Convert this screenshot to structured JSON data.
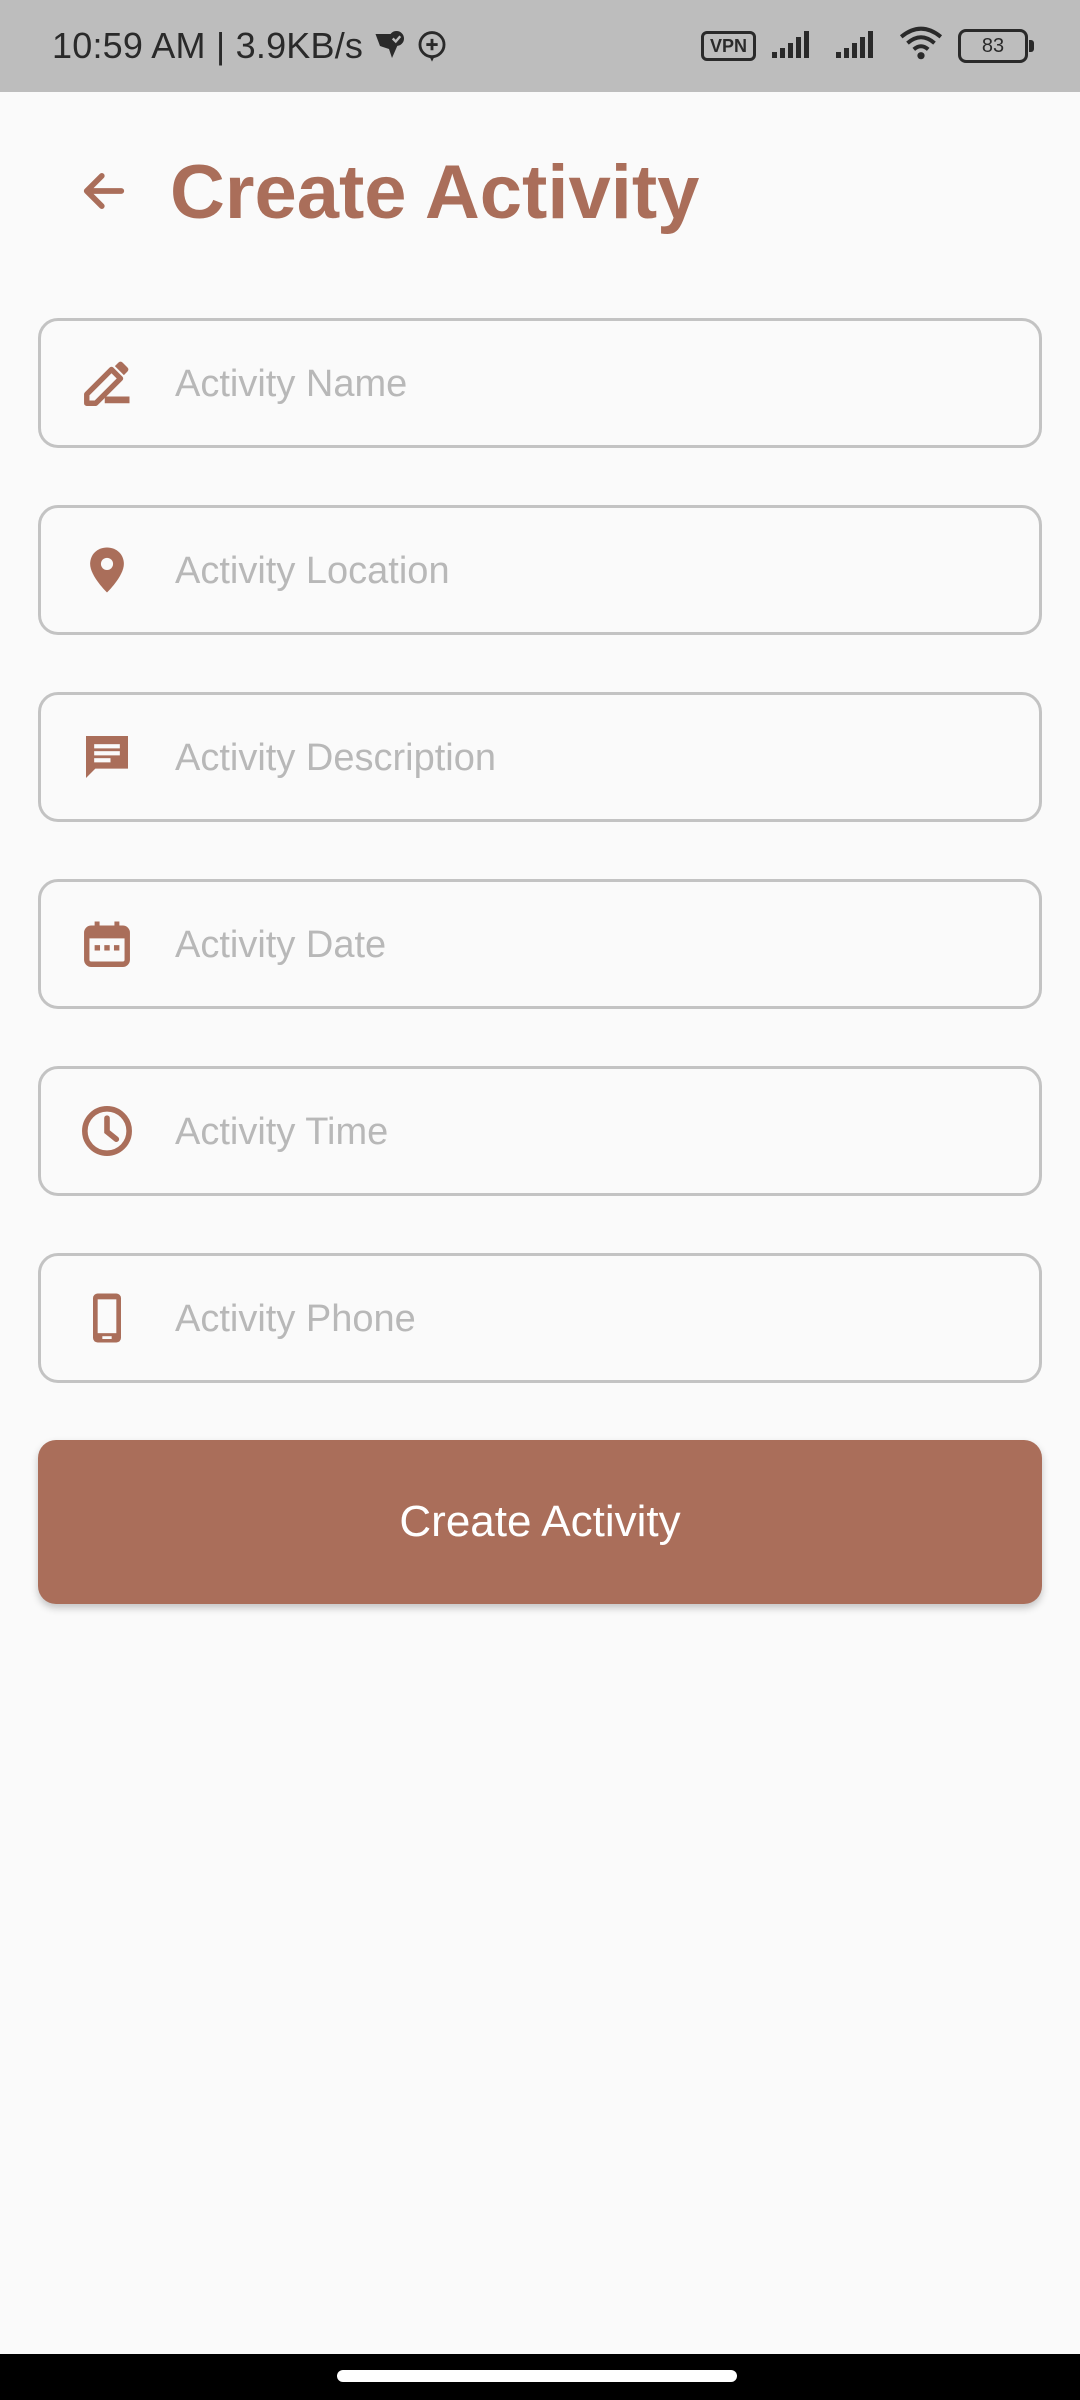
{
  "status_bar": {
    "time_speed": "10:59 AM | 3.9KB/s",
    "vpn": "VPN",
    "battery": "83"
  },
  "header": {
    "title": "Create Activity"
  },
  "form": {
    "fields": [
      {
        "icon": "edit-icon",
        "placeholder": "Activity Name",
        "value": ""
      },
      {
        "icon": "location-pin-icon",
        "placeholder": "Activity Location",
        "value": ""
      },
      {
        "icon": "message-icon",
        "placeholder": "Activity Description",
        "value": ""
      },
      {
        "icon": "calendar-icon",
        "placeholder": "Activity Date",
        "value": ""
      },
      {
        "icon": "clock-icon",
        "placeholder": "Activity Time",
        "value": ""
      },
      {
        "icon": "phone-icon",
        "placeholder": "Activity Phone",
        "value": ""
      }
    ],
    "submit_label": "Create Activity"
  },
  "colors": {
    "accent": "#aa6e5a",
    "field_border": "#c3c3c3",
    "placeholder": "#b8b8b8",
    "background": "#fafafa",
    "status_bar": "#bdbdbd"
  }
}
